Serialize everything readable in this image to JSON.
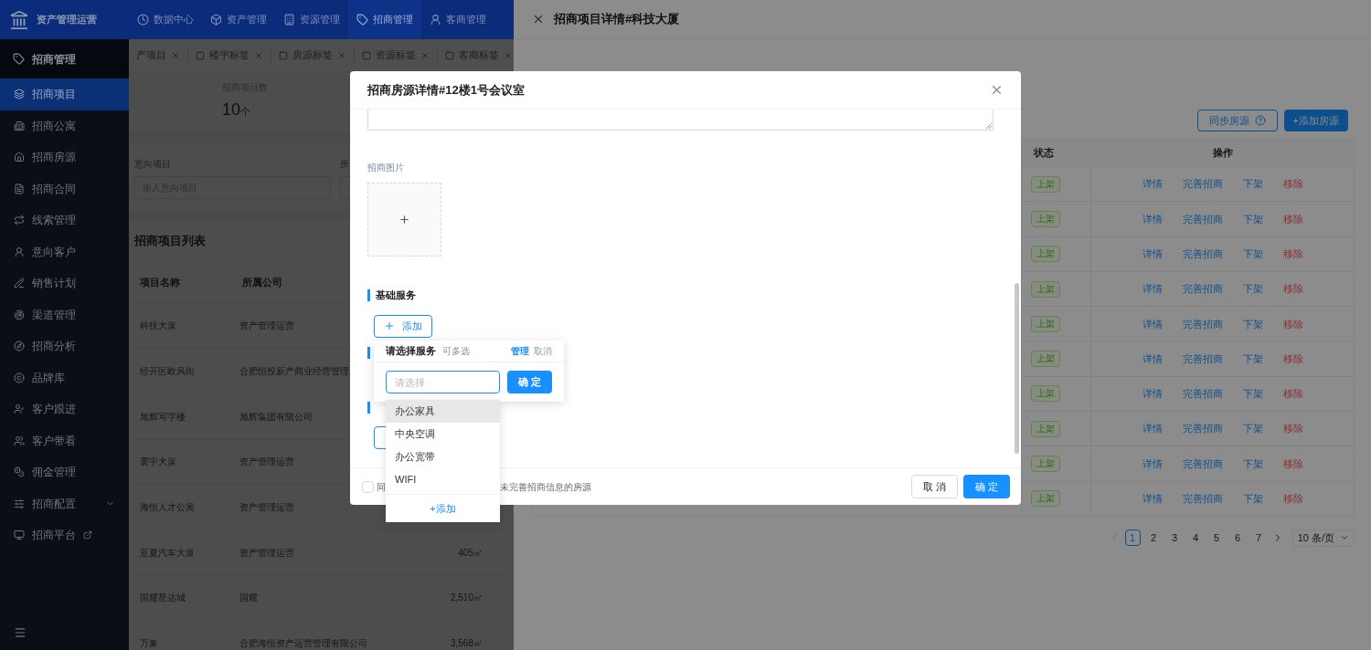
{
  "brand": {
    "name": "资产管理运营"
  },
  "top_nav": [
    {
      "label": "数据中心",
      "selected": false
    },
    {
      "label": "资产管理",
      "selected": false
    },
    {
      "label": "资源管理",
      "selected": false
    },
    {
      "label": "招商管理",
      "selected": true
    },
    {
      "label": "客商管理",
      "selected": false
    }
  ],
  "sidebar": {
    "title": "招商管理",
    "items": [
      {
        "label": "招商项目",
        "selected": true,
        "kind": "plain"
      },
      {
        "label": "招商公寓",
        "selected": false,
        "kind": "plain"
      },
      {
        "label": "招商房源",
        "selected": false,
        "kind": "plain"
      },
      {
        "label": "招商合同",
        "selected": false,
        "kind": "plain"
      },
      {
        "label": "线索管理",
        "selected": false,
        "kind": "plain"
      },
      {
        "label": "意向客户",
        "selected": false,
        "kind": "plain"
      },
      {
        "label": "销售计划",
        "selected": false,
        "kind": "plain"
      },
      {
        "label": "渠道管理",
        "selected": false,
        "kind": "plain"
      },
      {
        "label": "招商分析",
        "selected": false,
        "kind": "plain"
      },
      {
        "label": "品牌库",
        "selected": false,
        "kind": "plain"
      },
      {
        "label": "客户跟进",
        "selected": false,
        "kind": "plain"
      },
      {
        "label": "客户带看",
        "selected": false,
        "kind": "plain"
      },
      {
        "label": "佣金管理",
        "selected": false,
        "kind": "plain"
      },
      {
        "label": "招商配置",
        "selected": false,
        "kind": "submenu"
      },
      {
        "label": "招商平台",
        "selected": false,
        "kind": "external"
      }
    ]
  },
  "open_tabs": [
    {
      "label": "产项目"
    },
    {
      "label": "楼宇标签"
    },
    {
      "label": "房源标签"
    },
    {
      "label": "资源标签"
    },
    {
      "label": "客商标签"
    }
  ],
  "overview": {
    "stat_label": "招商项目数",
    "stat_value": "10",
    "stat_unit": "个"
  },
  "filters": [
    {
      "label": "意向项目",
      "placeholder": "输入意向项目"
    },
    {
      "label": "所"
    }
  ],
  "project_list": {
    "title": "招商项目列表",
    "columns": [
      "项目名称",
      "所属公司"
    ],
    "rows": [
      {
        "name": "科技大厦",
        "company": "资产管理运营"
      },
      {
        "name": "经开区欧风街",
        "company": "合肥恒投新产商业经营管理"
      },
      {
        "name": "旭辉写字楼",
        "company": "旭辉集团有限公司"
      },
      {
        "name": "寰宇大厦",
        "company": "资产管理运营"
      },
      {
        "name": "海恒人才公寓",
        "company": "资产管理运营"
      },
      {
        "name": "亚夏汽车大厦",
        "company": "资产管理运营",
        "area": "405㎡"
      },
      {
        "name": "国耀星达城",
        "company": "国耀",
        "area": "2,510㎡"
      },
      {
        "name": "万象",
        "company": "合肥海恒资产运营管理有限公司",
        "area": "3,568㎡"
      }
    ]
  },
  "drawer": {
    "title": "招商项目详情#科技大厦",
    "buttons": [
      {
        "label": "同步房源",
        "kind": "outline"
      },
      {
        "label": "+添加房源",
        "kind": "primary"
      }
    ],
    "table": {
      "columns": [
        "状态",
        "操作"
      ],
      "rows": [
        {
          "status": "上架",
          "actions": [
            {
              "label": "详情",
              "kind": "link"
            },
            {
              "label": "完善招商",
              "kind": "link"
            },
            {
              "label": "下架",
              "kind": "link"
            },
            {
              "label": "移除",
              "kind": "danger"
            }
          ]
        },
        {
          "status": "上架",
          "actions": [
            {
              "label": "详情",
              "kind": "link"
            },
            {
              "label": "完善招商",
              "kind": "link"
            },
            {
              "label": "下架",
              "kind": "link"
            },
            {
              "label": "移除",
              "kind": "danger"
            }
          ]
        },
        {
          "status": "上架",
          "actions": [
            {
              "label": "详情",
              "kind": "link"
            },
            {
              "label": "完善招商",
              "kind": "link"
            },
            {
              "label": "下架",
              "kind": "link"
            },
            {
              "label": "移除",
              "kind": "danger"
            }
          ]
        },
        {
          "status": "上架",
          "actions": [
            {
              "label": "详情",
              "kind": "link"
            },
            {
              "label": "完善招商",
              "kind": "link"
            },
            {
              "label": "下架",
              "kind": "link"
            },
            {
              "label": "移除",
              "kind": "danger"
            }
          ]
        },
        {
          "status": "上架",
          "actions": [
            {
              "label": "详情",
              "kind": "link"
            },
            {
              "label": "完善招商",
              "kind": "link"
            },
            {
              "label": "下架",
              "kind": "link"
            },
            {
              "label": "移除",
              "kind": "danger"
            }
          ]
        },
        {
          "status": "上架",
          "actions": [
            {
              "label": "详情",
              "kind": "link"
            },
            {
              "label": "完善招商",
              "kind": "link"
            },
            {
              "label": "下架",
              "kind": "link"
            },
            {
              "label": "移除",
              "kind": "danger"
            }
          ]
        },
        {
          "status": "上架",
          "actions": [
            {
              "label": "详情",
              "kind": "link"
            },
            {
              "label": "完善招商",
              "kind": "link"
            },
            {
              "label": "下架",
              "kind": "link"
            },
            {
              "label": "移除",
              "kind": "danger"
            }
          ]
        },
        {
          "status": "上架",
          "actions": [
            {
              "label": "详情",
              "kind": "link"
            },
            {
              "label": "完善招商",
              "kind": "link"
            },
            {
              "label": "下架",
              "kind": "link"
            },
            {
              "label": "移除",
              "kind": "danger"
            }
          ]
        },
        {
          "status": "上架",
          "actions": [
            {
              "label": "详情",
              "kind": "link"
            },
            {
              "label": "完善招商",
              "kind": "link"
            },
            {
              "label": "下架",
              "kind": "link"
            },
            {
              "label": "移除",
              "kind": "danger"
            }
          ]
        },
        {
          "status": "上架",
          "actions": [
            {
              "label": "详情",
              "kind": "link"
            },
            {
              "label": "完善招商",
              "kind": "link"
            },
            {
              "label": "下架",
              "kind": "link"
            },
            {
              "label": "移除",
              "kind": "danger"
            }
          ]
        }
      ]
    },
    "pagination": {
      "pages": [
        {
          "label": "1",
          "selected": true
        },
        {
          "label": "2",
          "selected": false
        },
        {
          "label": "3",
          "selected": false
        },
        {
          "label": "4",
          "selected": false
        },
        {
          "label": "5",
          "selected": false
        },
        {
          "label": "6",
          "selected": false
        },
        {
          "label": "7",
          "selected": false
        }
      ],
      "page_size": "10 条/页"
    }
  },
  "modal": {
    "title": "招商房源详情#12楼1号会议室",
    "image_label": "招商图片",
    "sections": [
      {
        "title": "基础服务",
        "add_label": "添加"
      }
    ],
    "footer": {
      "checked": false,
      "note_start": "同",
      "note_end": "未完善招商信息的房源",
      "buttons": [
        {
          "label": "取 消",
          "kind": "default"
        },
        {
          "label": "确 定",
          "kind": "primary"
        }
      ]
    }
  },
  "service_picker": {
    "title": "请选择服务",
    "hint": "可多选",
    "links": [
      {
        "label": "管理",
        "kind": "primary"
      },
      {
        "label": "取消",
        "kind": "muted"
      }
    ],
    "placeholder": "请选择",
    "confirm": "确 定",
    "options": [
      {
        "label": "办公家具",
        "highlighted": true
      },
      {
        "label": "中央空调",
        "highlighted": false
      },
      {
        "label": "办公宽带",
        "highlighted": false
      },
      {
        "label": "WIFI",
        "highlighted": false
      }
    ],
    "add_label": "+添加"
  }
}
